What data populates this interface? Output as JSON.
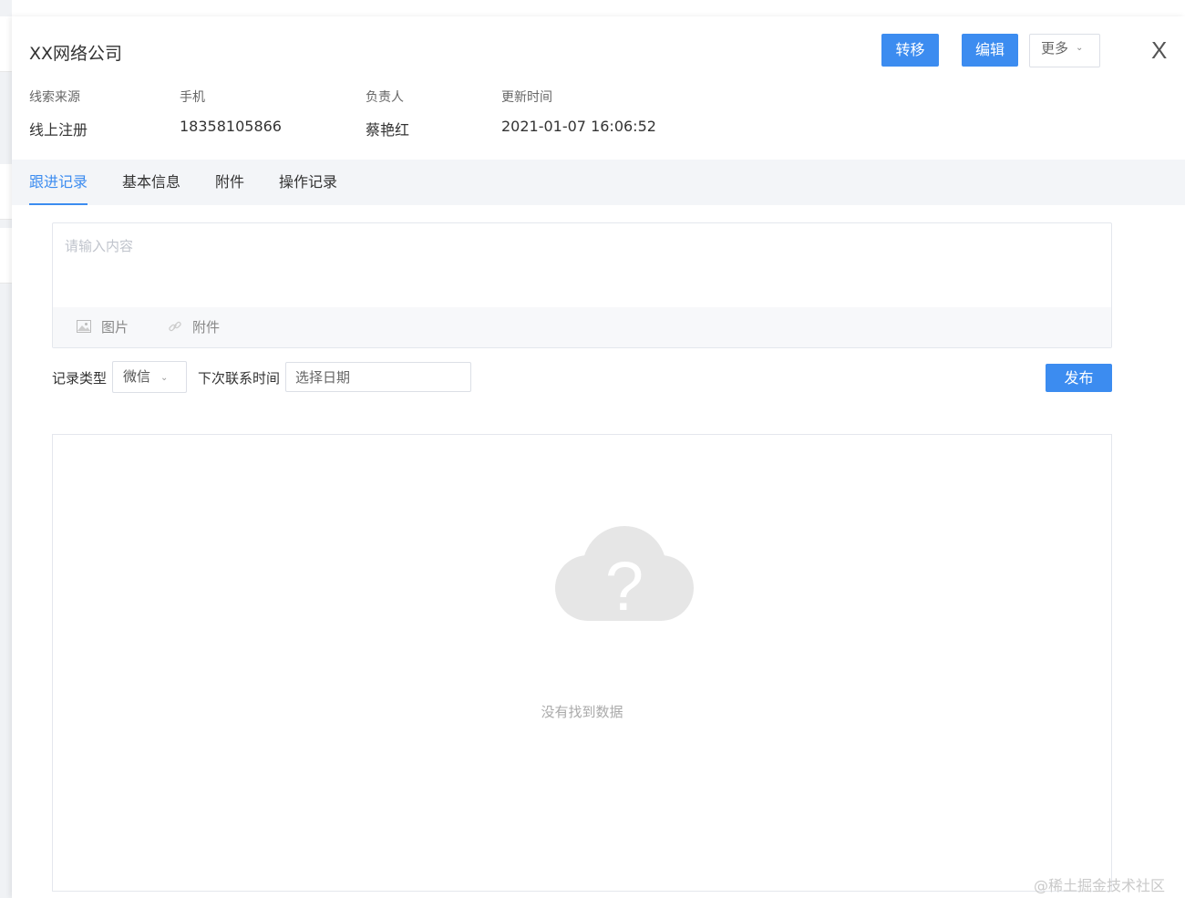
{
  "header": {
    "title": "XX网络公司",
    "transfer_label": "转移",
    "edit_label": "编辑",
    "more_label": "更多",
    "close_label": "X"
  },
  "info": [
    {
      "label": "线索来源",
      "value": "线上注册"
    },
    {
      "label": "手机",
      "value": "18358105866"
    },
    {
      "label": "负责人",
      "value": "蔡艳红"
    },
    {
      "label": "更新时间",
      "value": "2021-01-07 16:06:52"
    }
  ],
  "tabs": [
    {
      "label": "跟进记录",
      "active": true
    },
    {
      "label": "基本信息",
      "active": false
    },
    {
      "label": "附件",
      "active": false
    },
    {
      "label": "操作记录",
      "active": false
    }
  ],
  "editor": {
    "placeholder": "请输入内容",
    "image_label": "图片",
    "attachment_label": "附件"
  },
  "form": {
    "record_type_label": "记录类型",
    "record_type_value": "微信",
    "next_contact_label": "下次联系时间",
    "date_placeholder": "选择日期",
    "publish_label": "发布"
  },
  "empty_state": {
    "text": "没有找到数据"
  },
  "watermark": "@稀土掘金技术社区",
  "colors": {
    "accent": "#3c8cf0",
    "tab_bar_bg": "#f3f5f8",
    "empty_icon": "#e6e6e6"
  }
}
